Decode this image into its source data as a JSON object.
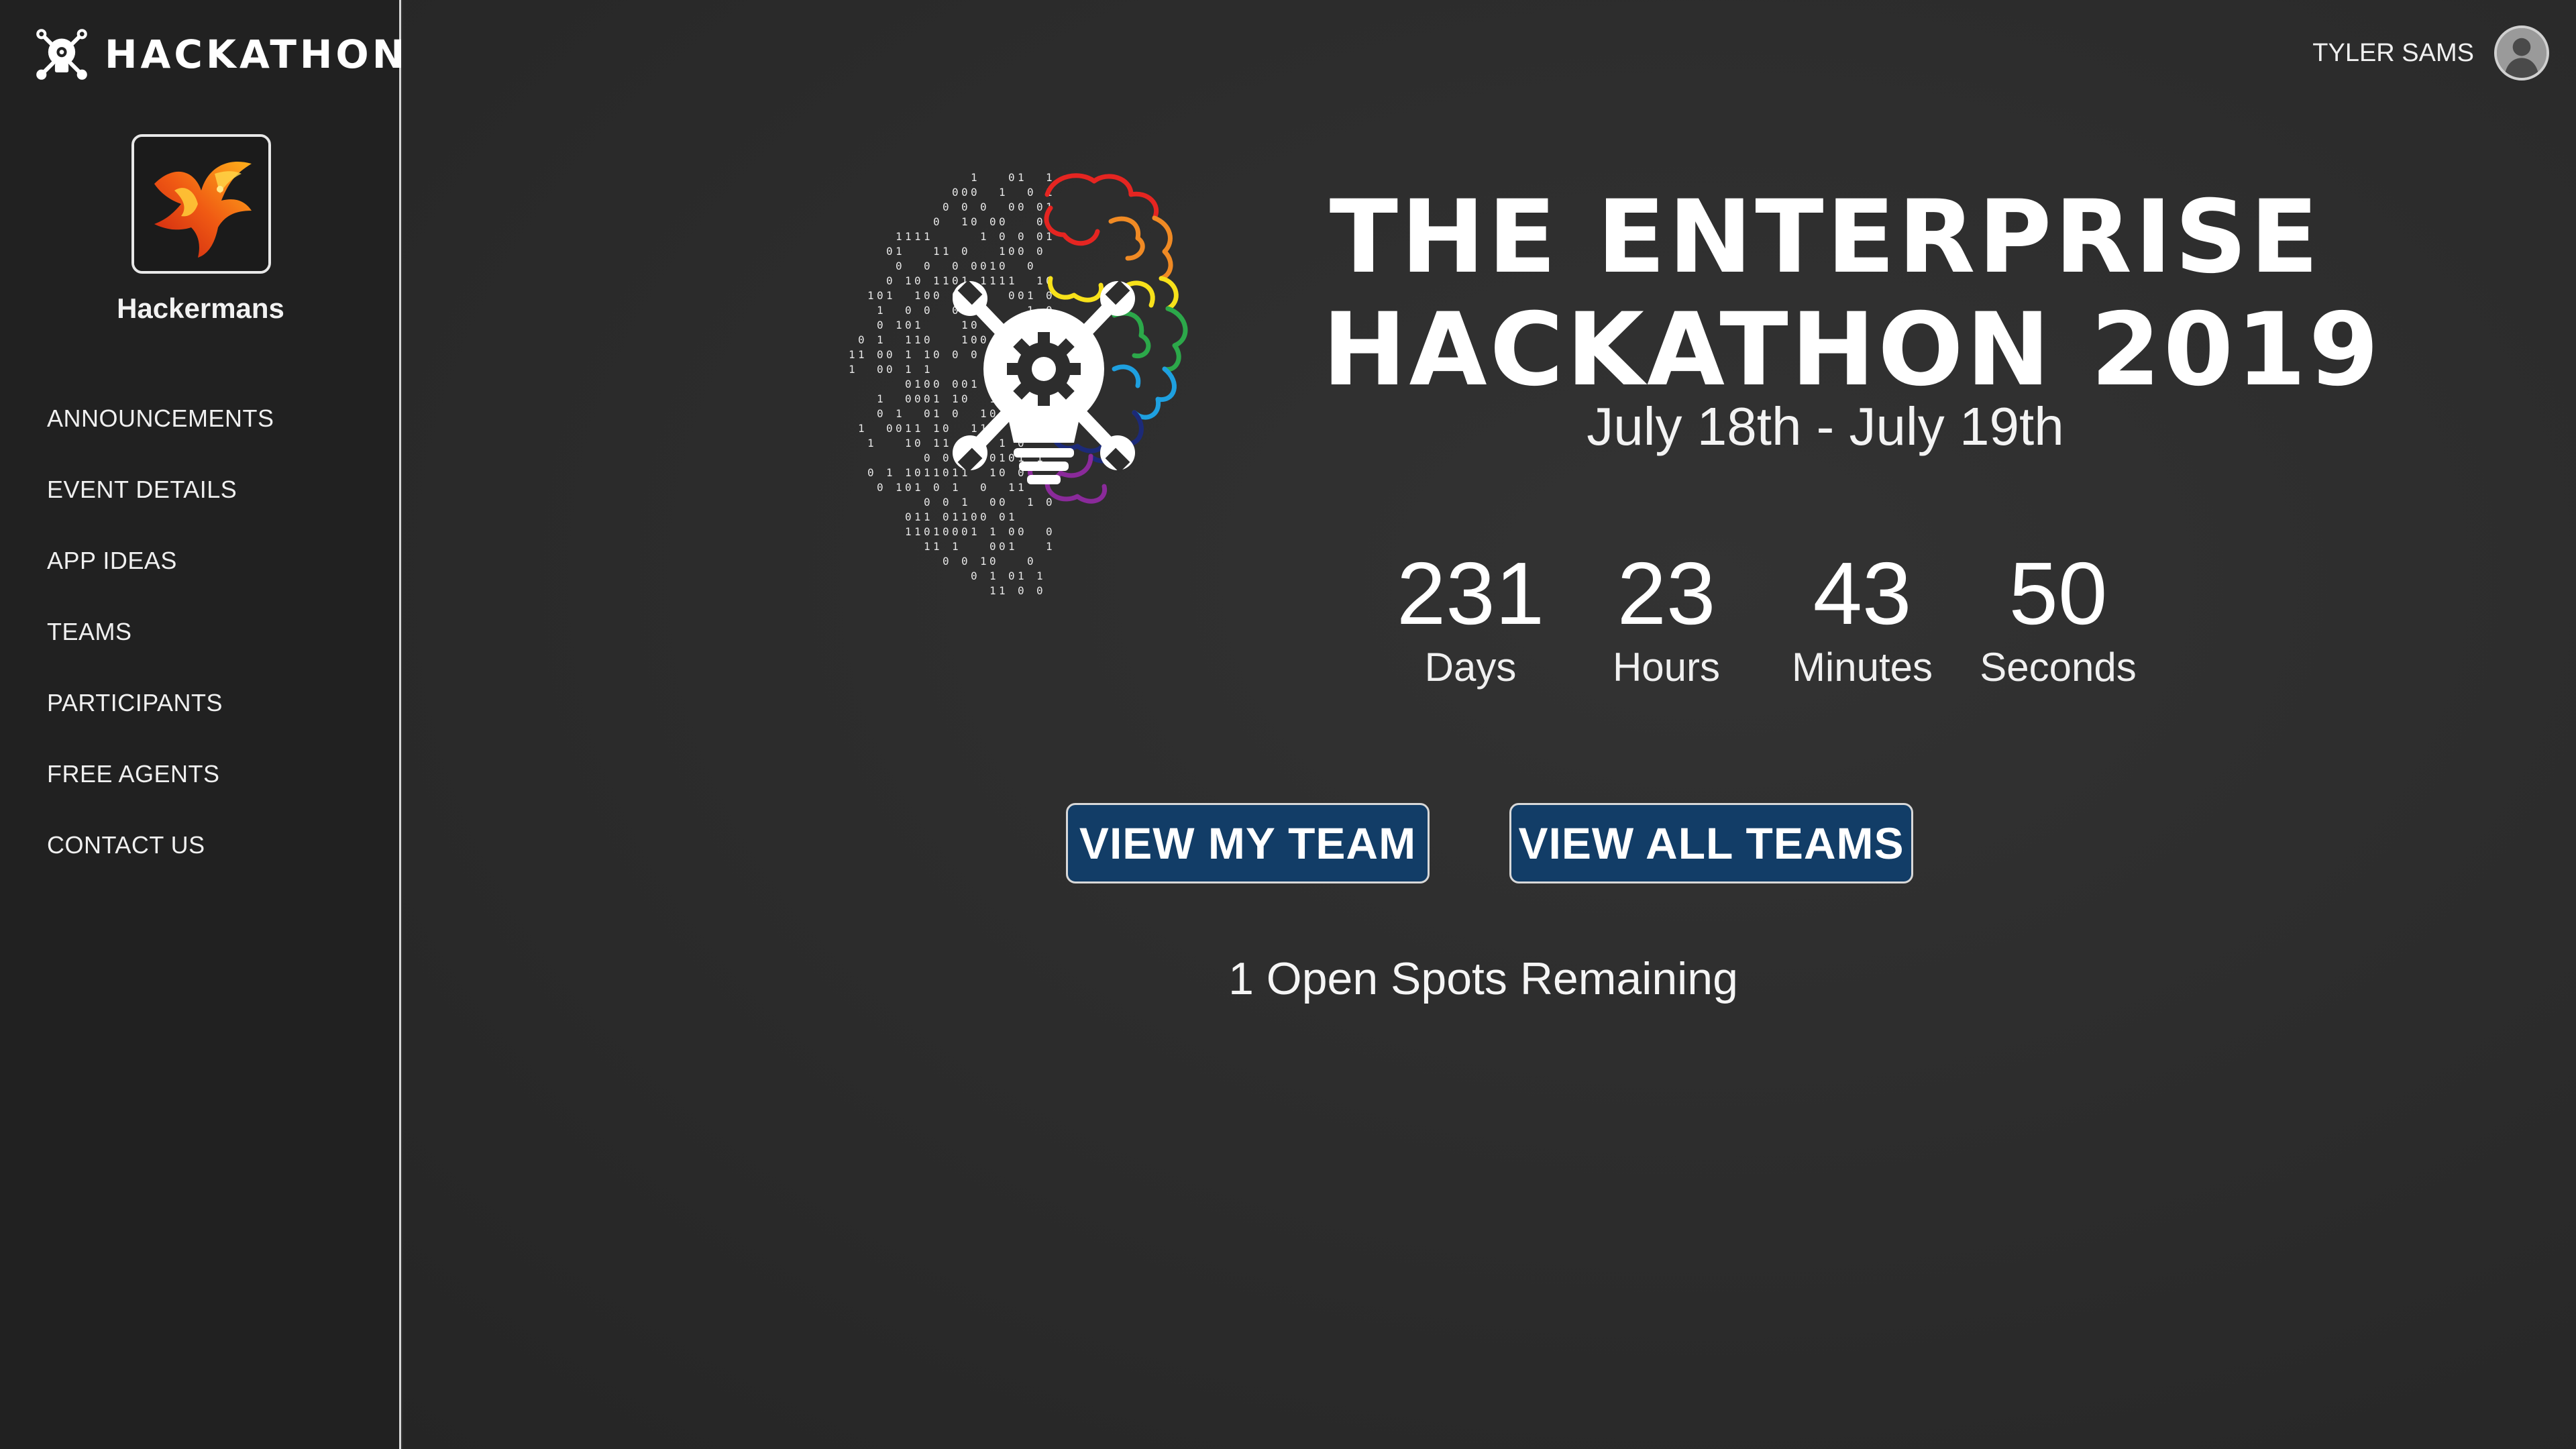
{
  "sidebar": {
    "brand": {
      "text": "HACKATHON",
      "icon": "bulb-wrench-icon"
    },
    "team": {
      "name": "Hackermans",
      "avatar": "phoenix-image"
    },
    "nav": [
      {
        "label": "ANNOUNCEMENTS"
      },
      {
        "label": "EVENT DETAILS"
      },
      {
        "label": "APP IDEAS"
      },
      {
        "label": "TEAMS"
      },
      {
        "label": "PARTICIPANTS"
      },
      {
        "label": "FREE AGENTS"
      },
      {
        "label": "CONTACT US"
      }
    ]
  },
  "header": {
    "user_name": "TYLER SAMS",
    "user_icon": "user-avatar-icon"
  },
  "hero": {
    "title_line1": "THE ENTERPRISE",
    "title_line2": "HACKATHON 2019",
    "dates": "July 18th - July 19th",
    "logo": "binary-brain-lightbulb-logo"
  },
  "countdown": {
    "days": {
      "value": "231",
      "label": "Days"
    },
    "hours": {
      "value": "23",
      "label": "Hours"
    },
    "minutes": {
      "value": "43",
      "label": "Minutes"
    },
    "seconds": {
      "value": "50",
      "label": "Seconds"
    }
  },
  "actions": {
    "view_my_team": "VIEW MY TEAM",
    "view_all_teams": "VIEW ALL TEAMS"
  },
  "spots_text": "1 Open Spots Remaining",
  "colors": {
    "sidebar_bg": "#212121",
    "main_bg": "#2d2d2d",
    "button_bg": "#123d67",
    "brain_red": "#e52521",
    "brain_orange": "#f08a24",
    "brain_yellow": "#f7e11a",
    "brain_green": "#2ca84a",
    "brain_blue": "#1ea0e0",
    "brain_navy": "#1c2a78",
    "brain_purple": "#8a2a9a"
  }
}
